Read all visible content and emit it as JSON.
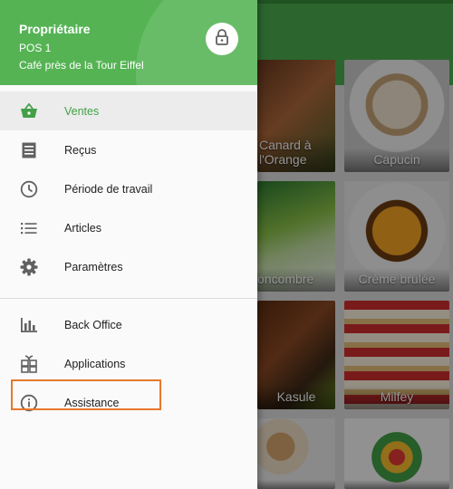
{
  "drawer": {
    "owner": "Propriétaire",
    "pos": "POS 1",
    "store": "Café près de la Tour Eiffel",
    "lock_icon": "lock-icon"
  },
  "menu": {
    "items": [
      {
        "label": "Ventes",
        "icon": "basket-icon",
        "active": true
      },
      {
        "label": "Reçus",
        "icon": "receipt-icon"
      },
      {
        "label": "Période de travail",
        "icon": "clock-icon"
      },
      {
        "label": "Articles",
        "icon": "list-icon"
      },
      {
        "label": "Paramètres",
        "icon": "gear-icon"
      }
    ],
    "secondary": [
      {
        "label": "Back Office",
        "icon": "bar-chart-icon"
      },
      {
        "label": "Applications",
        "icon": "apps-icon"
      },
      {
        "label": "Assistance",
        "icon": "info-icon",
        "highlighted": true
      }
    ]
  },
  "products": [
    {
      "label": "Canard à l'Orange"
    },
    {
      "label": "Capucin"
    },
    {
      "label": "oncombre"
    },
    {
      "label": "Crème brulée"
    },
    {
      "label": "Kasule"
    },
    {
      "label": "Milfey"
    },
    {
      "label": ""
    },
    {
      "label": ""
    }
  ],
  "colors": {
    "primary": "#4caf50",
    "active_text": "#43a047",
    "highlight": "#e8782a"
  }
}
